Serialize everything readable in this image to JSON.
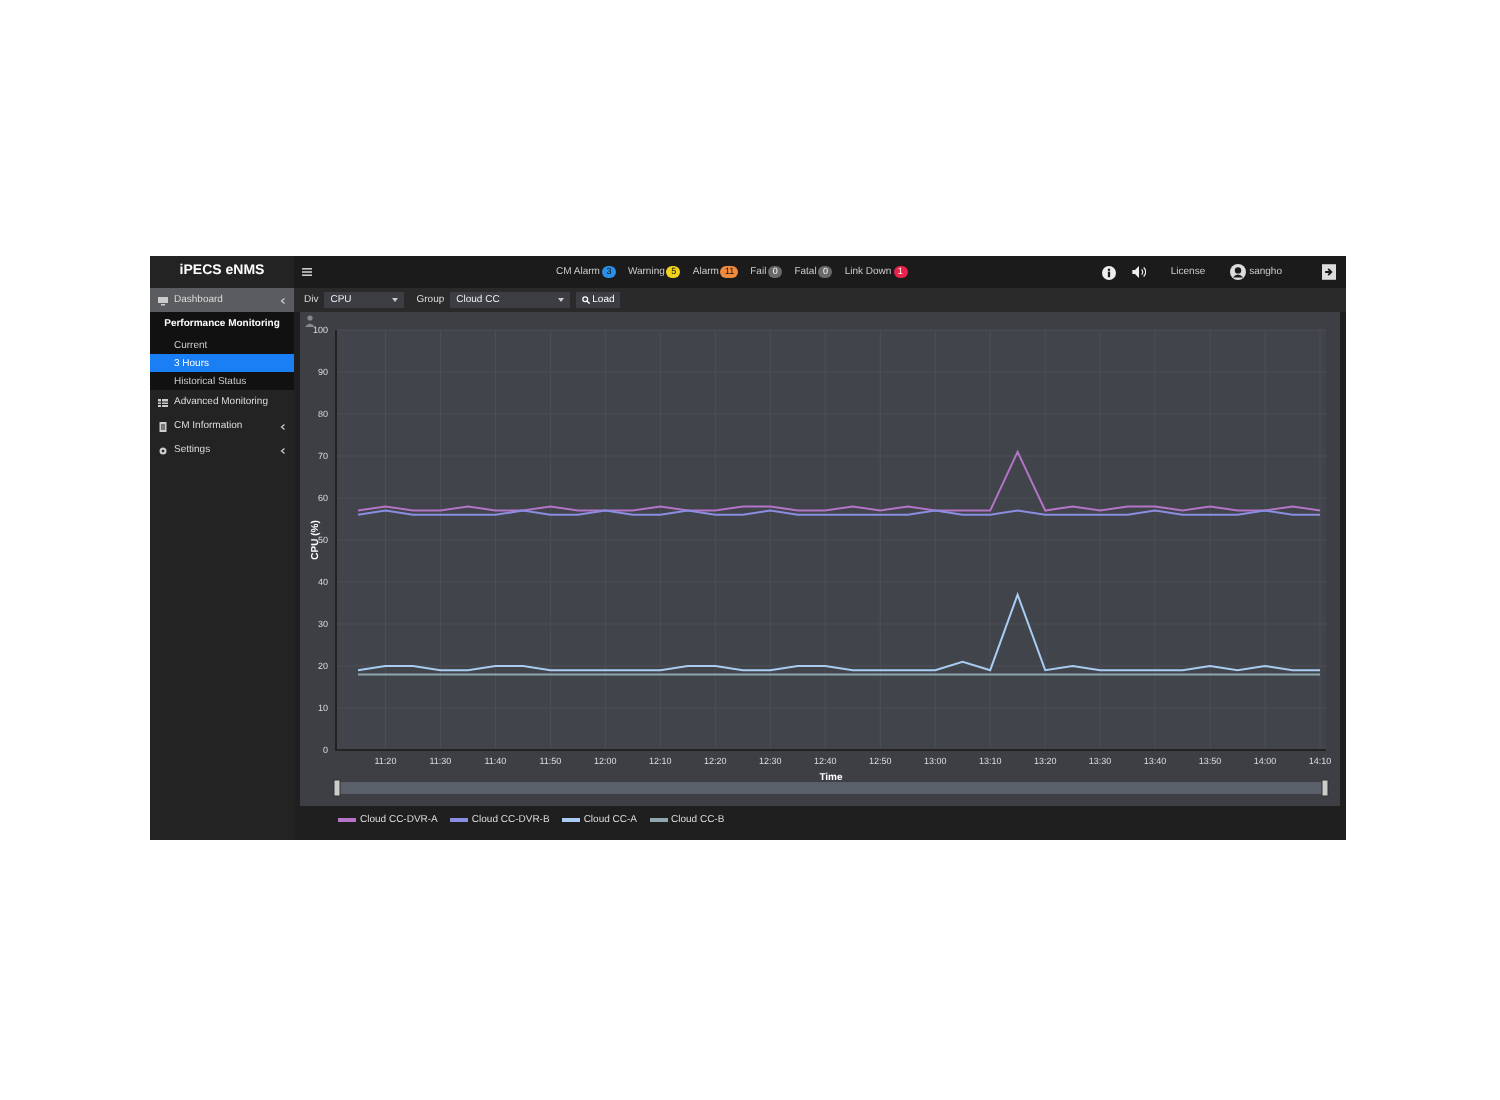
{
  "header": {
    "logo": "iPECS eNMS",
    "alarms": [
      {
        "label": "CM Alarm",
        "count": "3",
        "color": "#2b8fe8"
      },
      {
        "label": "Warning",
        "count": "5",
        "color": "#f2d21b"
      },
      {
        "label": "Alarm",
        "count": "11",
        "color": "#f08a3c"
      },
      {
        "label": "Fail",
        "count": "0",
        "color": "#6a6a6a"
      },
      {
        "label": "Fatal",
        "count": "0",
        "color": "#6a6a6a"
      },
      {
        "label": "Link Down",
        "count": "1",
        "color": "#e8234a"
      }
    ],
    "license": "License",
    "user": "sangho"
  },
  "sidebar": {
    "items": [
      {
        "label": "Dashboard",
        "kind": "group",
        "selected": true,
        "expanded": false
      },
      {
        "label": "Performance Monitoring",
        "kind": "group",
        "selected": false,
        "expanded": true,
        "children": [
          {
            "label": "Current",
            "selected": false
          },
          {
            "label": "3 Hours",
            "selected": true
          },
          {
            "label": "Historical Status",
            "selected": false
          }
        ]
      },
      {
        "label": "Advanced Monitoring",
        "kind": "link",
        "selected": false
      },
      {
        "label": "CM Information",
        "kind": "group",
        "selected": false,
        "expanded": false
      },
      {
        "label": "Settings",
        "kind": "group",
        "selected": false,
        "expanded": false
      }
    ]
  },
  "toolbar": {
    "div_label": "Div",
    "div_value": "CPU",
    "group_label": "Group",
    "group_value": "Cloud CC",
    "load_button": "Load"
  },
  "chart_data": {
    "type": "line",
    "xlabel": "Time",
    "ylabel": "CPU (%)",
    "ylim": [
      0,
      100
    ],
    "grid": true,
    "categories": [
      null,
      "11:20",
      null,
      "11:30",
      null,
      "11:40",
      null,
      "11:50",
      null,
      "12:00",
      null,
      "12:10",
      null,
      "12:20",
      null,
      "12:30",
      null,
      "12:40",
      null,
      "12:50",
      null,
      "13:00",
      null,
      "13:10",
      null,
      "13:20",
      null,
      "13:30",
      null,
      "13:40",
      null,
      "13:50",
      null,
      "14:00",
      null,
      "14:10"
    ],
    "yticks": [
      0,
      10,
      20,
      30,
      40,
      50,
      60,
      70,
      80,
      90,
      100
    ],
    "series": [
      {
        "name": "Cloud CC-DVR-A",
        "color": "#b474c8",
        "values": [
          57,
          58,
          57,
          57,
          58,
          57,
          57,
          58,
          57,
          57,
          57,
          58,
          57,
          57,
          58,
          58,
          57,
          57,
          58,
          57,
          58,
          57,
          57,
          57,
          71,
          57,
          58,
          57,
          58,
          58,
          57,
          58,
          57,
          57,
          58,
          57
        ]
      },
      {
        "name": "Cloud CC-DVR-B",
        "color": "#8a8ee0",
        "values": [
          56,
          57,
          56,
          56,
          56,
          56,
          57,
          56,
          56,
          57,
          56,
          56,
          57,
          56,
          56,
          57,
          56,
          56,
          56,
          56,
          56,
          57,
          56,
          56,
          57,
          56,
          56,
          56,
          56,
          57,
          56,
          56,
          56,
          57,
          56,
          56
        ]
      },
      {
        "name": "Cloud CC-A",
        "color": "#a9cdf2",
        "values": [
          19,
          20,
          20,
          19,
          19,
          20,
          20,
          19,
          19,
          19,
          19,
          19,
          20,
          20,
          19,
          19,
          20,
          20,
          19,
          19,
          19,
          19,
          21,
          19,
          37,
          19,
          20,
          19,
          19,
          19,
          19,
          20,
          19,
          20,
          19,
          19
        ]
      },
      {
        "name": "Cloud CC-B",
        "color": "#8fa6ae",
        "values": [
          18,
          18,
          18,
          18,
          18,
          18,
          18,
          18,
          18,
          18,
          18,
          18,
          18,
          18,
          18,
          18,
          18,
          18,
          18,
          18,
          18,
          18,
          18,
          18,
          18,
          18,
          18,
          18,
          18,
          18,
          18,
          18,
          18,
          18,
          18,
          18
        ]
      }
    ]
  }
}
